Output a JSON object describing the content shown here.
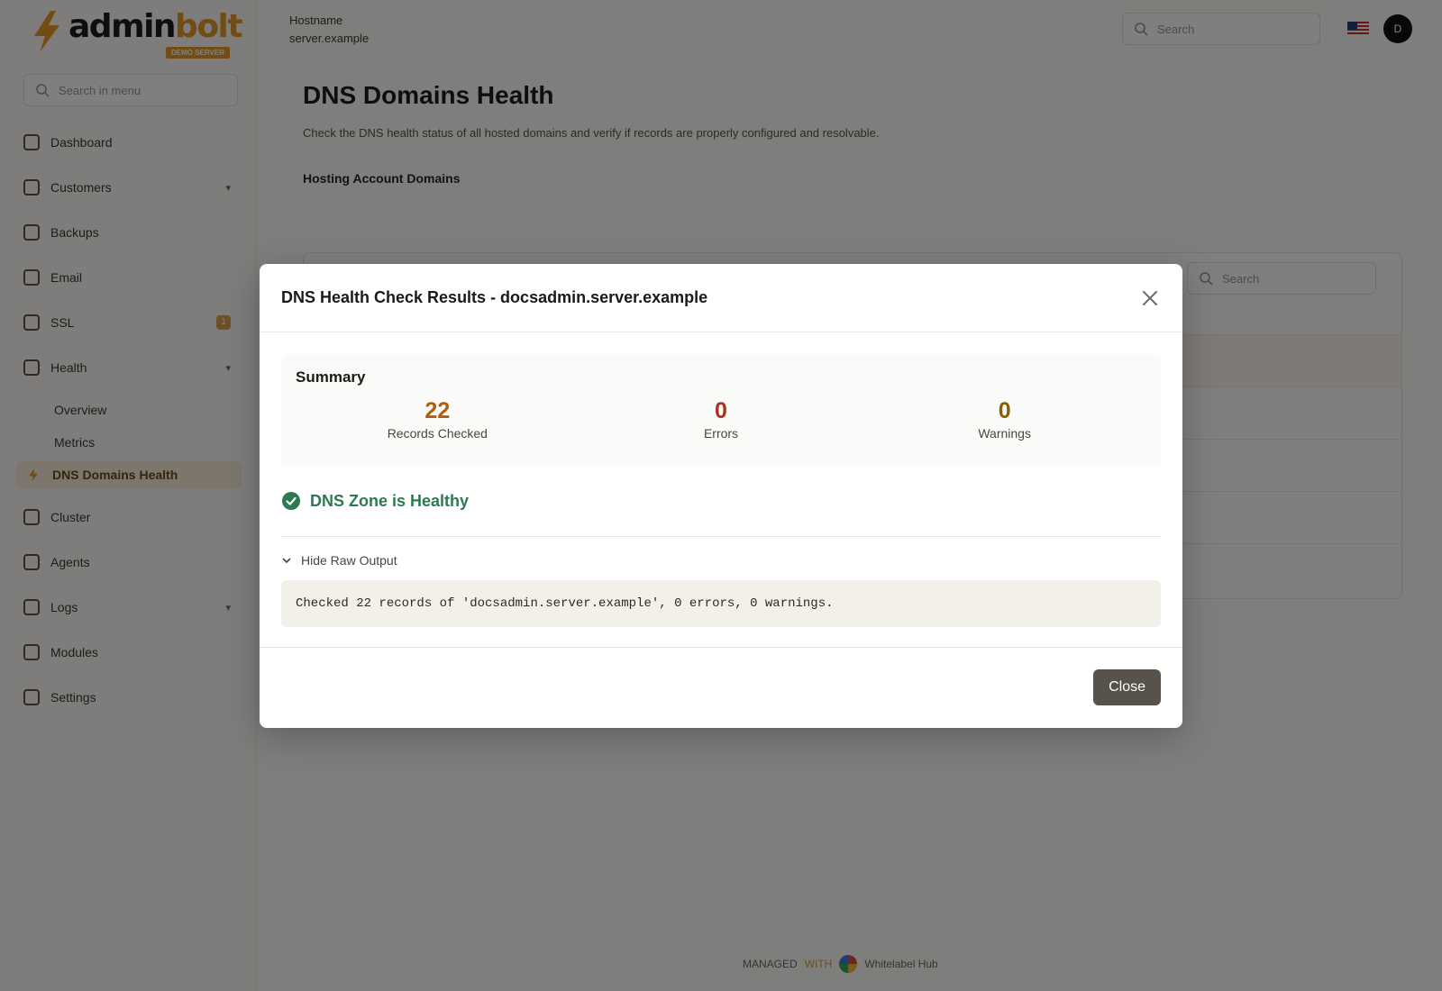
{
  "brand": {
    "name_part1": "admin",
    "name_part2": "bolt",
    "tagline": "DEMO SERVER"
  },
  "sidebar": {
    "search_placeholder": "Search in menu",
    "items": [
      {
        "label": "Dashboard"
      },
      {
        "label": "Customers"
      },
      {
        "label": "Backups"
      },
      {
        "label": "Email"
      },
      {
        "label": "SSL",
        "badge": "1"
      },
      {
        "label": "Health"
      },
      {
        "label": "Cluster"
      },
      {
        "label": "Agents"
      },
      {
        "label": "Logs"
      },
      {
        "label": "Modules"
      },
      {
        "label": "Settings"
      }
    ],
    "health_sub": [
      {
        "label": "Overview"
      },
      {
        "label": "Metrics"
      },
      {
        "label": "DNS Domains Health"
      }
    ]
  },
  "topbar": {
    "host_label": "Hostname",
    "host_value": "server.example",
    "search_placeholder": "Search",
    "avatar_initial": "D"
  },
  "page": {
    "title": "DNS Domains Health",
    "description": "Check the DNS health status of all hosted domains and verify if records are properly configured and resolvable.",
    "section_title": "Hosting Account Domains",
    "table_search_placeholder": "Search"
  },
  "footer": {
    "text_left": "MANAGED",
    "text_mid": "WITH",
    "text_right": "Whitelabel Hub"
  },
  "modal": {
    "title": "DNS Health Check Results - docsadmin.server.example",
    "summary_title": "Summary",
    "stats": [
      {
        "value": "22",
        "label": "Records Checked",
        "color": "#b05e0c"
      },
      {
        "value": "0",
        "label": "Errors",
        "color": "#a8321f"
      },
      {
        "value": "0",
        "label": "Warnings",
        "color": "#8a5c06"
      }
    ],
    "status_text": "DNS Zone is Healthy",
    "status_color": "#2d7a50",
    "raw_toggle_label": "Hide Raw Output",
    "raw_output": "Checked 22 records of 'docsadmin.server.example', 0 errors, 0 warnings.",
    "close_label": "Close"
  }
}
